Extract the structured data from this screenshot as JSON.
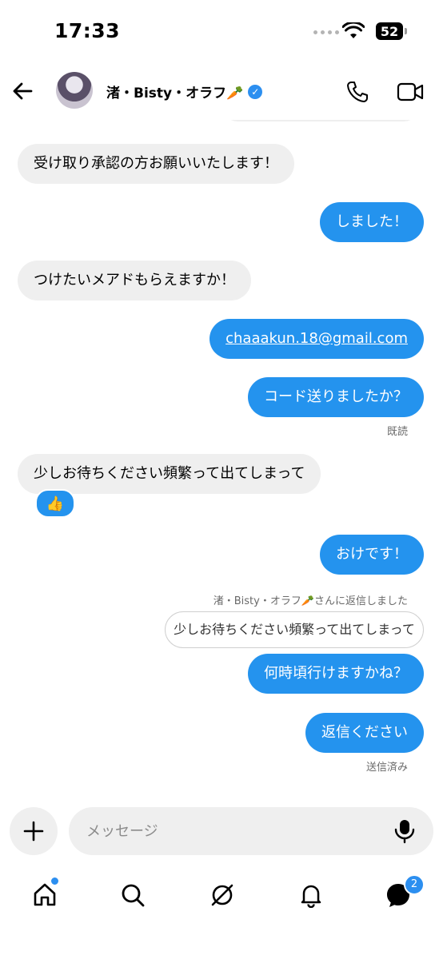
{
  "status_bar": {
    "time": "17:33",
    "battery": "52"
  },
  "header": {
    "contact_name": "渚・Bisty・オラフ🥕",
    "verified_icon": "✓",
    "back_icon": "arrow-left-icon",
    "call_icon": "phone-icon",
    "video_icon": "video-camera-icon"
  },
  "messages": [
    {
      "side": "in",
      "text": "受け取り承認の方お願いいたします！"
    },
    {
      "side": "out",
      "text": "しました！"
    },
    {
      "side": "in",
      "text": "つけたいメアドもらえますか！"
    },
    {
      "side": "out",
      "text": "chaaakun.18@gmail.com"
    },
    {
      "side": "out",
      "text": "コード送りましたか？"
    },
    {
      "side": "meta",
      "text": "既読"
    },
    {
      "side": "in",
      "text": "少しお待ちください頻繁って出てしまって"
    },
    {
      "side": "out",
      "text": "おけです！"
    },
    {
      "side": "out",
      "text": "何時頃行けますかね？"
    },
    {
      "side": "out",
      "text": "返信ください"
    },
    {
      "side": "meta",
      "text": "送信済み"
    }
  ],
  "reaction": "👍",
  "reply": {
    "note": "渚・Bisty・オラフ🥕さんに返信しました",
    "quoted": "少しお待ちください頻繁って出てしまって"
  },
  "composer": {
    "placeholder": "メッセージ"
  },
  "tab_bar": {
    "message_badge": "2",
    "items": [
      "home-icon",
      "search-icon",
      "explore-icon",
      "notifications-bell-icon",
      "messages-icon"
    ]
  },
  "colors": {
    "outgoing_bubble": "#2493ee",
    "incoming_bubble": "#efefef",
    "accent": "#2c8ff0"
  }
}
